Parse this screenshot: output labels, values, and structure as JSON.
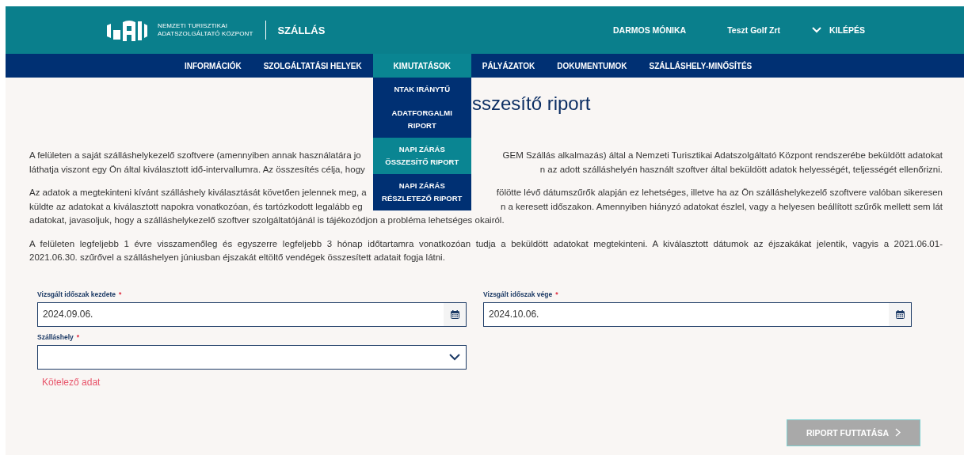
{
  "header": {
    "org_name": [
      "NEMZETI TURISZTIKAI",
      "ADATSZOLGÁLTATÓ KÖZPONT"
    ],
    "app_name": "SZÁLLÁS",
    "user_name": "DARMOS MÓNIKA",
    "organization": "Teszt Golf Zrt",
    "logout": "KILÉPÉS"
  },
  "nav": [
    {
      "label": "INFORMÁCIÓK",
      "selected": false
    },
    {
      "label": "SZOLGÁLTATÁSI HELYEK",
      "selected": false
    },
    {
      "label": "KIMUTATÁSOK",
      "selected": true
    },
    {
      "label": "PÁLYÁZATOK",
      "selected": false
    },
    {
      "label": "DOKUMENTUMOK",
      "selected": false
    },
    {
      "label": "SZÁLLÁSHELY-MINŐSÍTÉS",
      "selected": false
    }
  ],
  "dropdown": [
    {
      "lines": [
        "NTAK IRÁNYTŰ"
      ],
      "selected": false
    },
    {
      "lines": [
        "ADATFORGALMI",
        "RIPORT"
      ],
      "selected": false
    },
    {
      "lines": [
        "NAPI ZÁRÁS",
        "ÖSSZESÍTŐ RIPORT"
      ],
      "selected": true
    },
    {
      "lines": [
        "NAPI ZÁRÁS",
        "RÉSZLETEZŐ RIPORT"
      ],
      "selected": false
    }
  ],
  "page_title": "sszesítő riport",
  "paragraphs": [
    [
      {
        "left": "A felületen a saját szálláshelykezelő szoftvere (amennyiben annak használatára jo",
        "right": "GEM Szállás alkalmazás) által a Nemzeti Turisztikai Adatszolgáltató Központ rendszerébe beküldött adatokat"
      },
      {
        "left": "láthatja viszont egy Ön által kiválasztott idő-intervallumra. Az összesítés célja, hogy",
        "right": "n az adott szálláshelyén használt szoftver által beküldött adatok helyességét, teljességét ellenőrizni."
      }
    ],
    [
      {
        "left": "Az adatok a megtekinteni kívánt szálláshely kiválasztását követően jelennek meg, a",
        "right": "fölötte lévő dátumszűrők alapján ez lehetséges, illetve ha az Ön szálláshelykezelő szoftvere valóban sikeresen"
      },
      {
        "left": "küldte az adatokat a kiválasztott napokra vonatkozóan, és tartózkodott legalább eg",
        "right": "n a keresett időszakon. Amennyiben hiányzó adatokat észlel, vagy a helyesen beállított szűrők mellett sem lát"
      },
      {
        "full": "adatokat, javasoljuk, hogy a szálláshelykezelő szoftver szolgáltatójánál is tájékozódjon a probléma lehetséges okairól."
      }
    ],
    [
      {
        "full": "A felületen legfeljebb 1 évre visszamenőleg és egyszerre legfeljebb 3 hónap időtartamra vonatkozóan tudja a beküldött adatokat megtekinteni. A kiválasztott dátumok az éjszakákat jelentik, vagyis a 2021.06.01-"
      },
      {
        "full": "2021.06.30. szűrővel a szálláshelyen júniusban éjszakát eltöltő vendégek összesített adatait fogja látni."
      }
    ]
  ],
  "fields": [
    {
      "kind": "date",
      "label": "Vizsgált időszak kezdete",
      "required_mark": "*",
      "value": "2024.09.06."
    },
    {
      "kind": "date",
      "label": "Vizsgált időszak vége",
      "required_mark": "*",
      "value": "2024.10.06."
    },
    {
      "kind": "select",
      "label": "Szálláshely",
      "required_mark": "*",
      "error": "Kötelező adat"
    }
  ],
  "run_button": {
    "label": "RIPORT FUTTATÁSA",
    "disabled": true
  }
}
